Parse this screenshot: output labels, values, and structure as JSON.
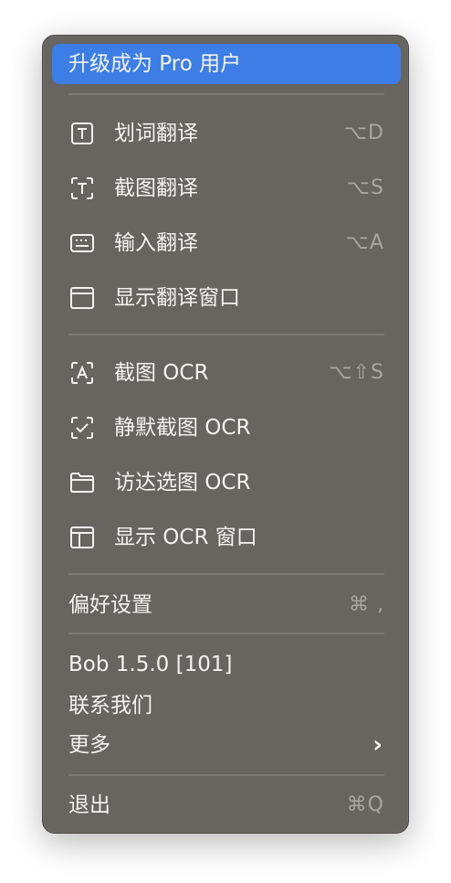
{
  "menu": {
    "upgrade": "升级成为 Pro 用户",
    "items": [
      {
        "label": "划词翻译",
        "icon": "text-select-icon",
        "shortcut": "⌥D"
      },
      {
        "label": "截图翻译",
        "icon": "screenshot-text-icon",
        "shortcut": "⌥S"
      },
      {
        "label": "输入翻译",
        "icon": "keyboard-icon",
        "shortcut": "⌥A"
      },
      {
        "label": "显示翻译窗口",
        "icon": "window-icon",
        "shortcut": ""
      },
      {
        "label": "截图 OCR",
        "icon": "screenshot-ocr-icon",
        "shortcut": "⌥⇧S"
      },
      {
        "label": "静默截图 OCR",
        "icon": "silent-screenshot-icon",
        "shortcut": ""
      },
      {
        "label": "访达选图 OCR",
        "icon": "folder-icon",
        "shortcut": ""
      },
      {
        "label": "显示 OCR 窗口",
        "icon": "ocr-window-icon",
        "shortcut": ""
      }
    ],
    "preferences": {
      "label": "偏好设置",
      "shortcut": "⌘ ,"
    },
    "version": "Bob 1.5.0 [101]",
    "contact": "联系我们",
    "more": "更多",
    "more_chevron": "›",
    "quit": {
      "label": "退出",
      "shortcut": "⌘Q"
    }
  }
}
